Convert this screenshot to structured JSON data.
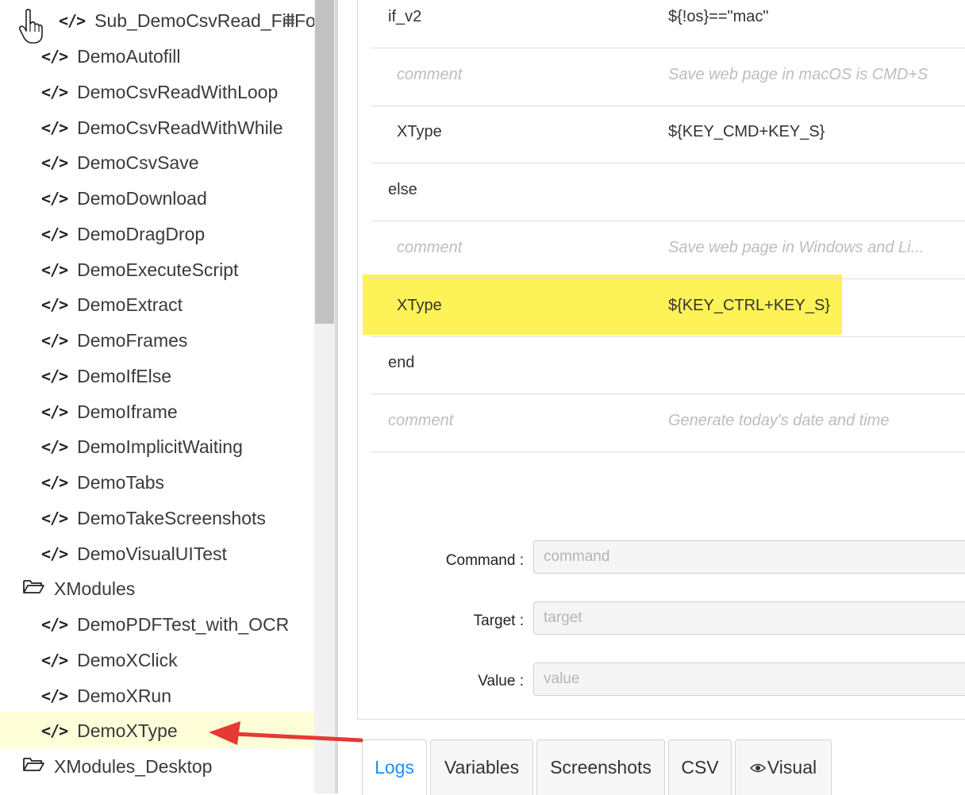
{
  "sidebar": {
    "partial_item": "Sub_DemoCsvRead_FillForm",
    "items": [
      {
        "label": "DemoAutofill",
        "type": "macro"
      },
      {
        "label": "DemoCsvReadWithLoop",
        "type": "macro"
      },
      {
        "label": "DemoCsvReadWithWhile",
        "type": "macro"
      },
      {
        "label": "DemoCsvSave",
        "type": "macro"
      },
      {
        "label": "DemoDownload",
        "type": "macro"
      },
      {
        "label": "DemoDragDrop",
        "type": "macro"
      },
      {
        "label": "DemoExecuteScript",
        "type": "macro"
      },
      {
        "label": "DemoExtract",
        "type": "macro"
      },
      {
        "label": "DemoFrames",
        "type": "macro"
      },
      {
        "label": "DemoIfElse",
        "type": "macro"
      },
      {
        "label": "DemoIframe",
        "type": "macro"
      },
      {
        "label": "DemoImplicitWaiting",
        "type": "macro"
      },
      {
        "label": "DemoTabs",
        "type": "macro"
      },
      {
        "label": "DemoTakeScreenshots",
        "type": "macro"
      },
      {
        "label": "DemoVisualUITest",
        "type": "macro"
      },
      {
        "label": "XModules",
        "type": "folder"
      },
      {
        "label": "DemoPDFTest_with_OCR",
        "type": "macro"
      },
      {
        "label": "DemoXClick",
        "type": "macro"
      },
      {
        "label": "DemoXRun",
        "type": "macro"
      },
      {
        "label": "DemoXType",
        "type": "macro",
        "selected": true
      },
      {
        "label": "XModules_Desktop",
        "type": "folder"
      }
    ],
    "selected_color": "#fdfdd7"
  },
  "commands": [
    {
      "command": "if_v2",
      "target": "${!os}==\"mac\"",
      "comment": false,
      "indent": false
    },
    {
      "command": "comment",
      "target": "Save web page in macOS is CMD+S",
      "comment": true,
      "indent": true
    },
    {
      "command": "XType",
      "target": "${KEY_CMD+KEY_S}",
      "comment": false,
      "indent": true
    },
    {
      "command": "else",
      "target": "",
      "comment": false,
      "indent": false
    },
    {
      "command": "comment",
      "target": "Save web page in Windows and Li...",
      "comment": true,
      "indent": true
    },
    {
      "command": "XType",
      "target": "${KEY_CTRL+KEY_S}",
      "comment": false,
      "indent": true,
      "highlighted": true
    },
    {
      "command": "end",
      "target": "",
      "comment": false,
      "indent": false
    },
    {
      "command": "comment",
      "target": "Generate today's date and time",
      "comment": true,
      "indent": false
    }
  ],
  "highlight_color": "#fdf356",
  "form": {
    "command_label": "Command",
    "command_placeholder": "command",
    "target_label": "Target",
    "target_placeholder": "target",
    "value_label": "Value",
    "value_placeholder": "value"
  },
  "tabs": [
    {
      "label": "Logs",
      "active": true
    },
    {
      "label": "Variables",
      "active": false
    },
    {
      "label": "Screenshots",
      "active": false
    },
    {
      "label": "CSV",
      "active": false
    },
    {
      "label": "Visual",
      "active": false,
      "icon": "eye-icon"
    }
  ],
  "accent_color": "#1890ff",
  "annotation_arrow_color": "#e53935"
}
